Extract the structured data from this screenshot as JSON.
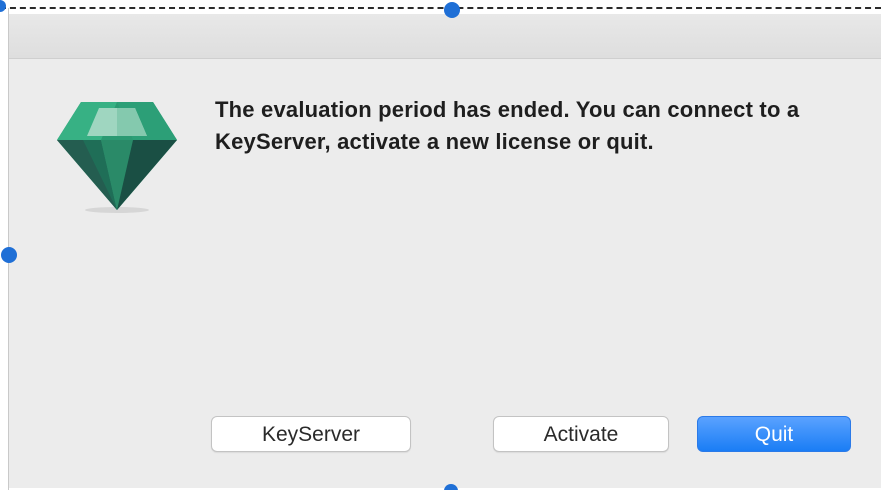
{
  "dialog": {
    "message": "The evaluation period has ended. You can connect to a KeyServer, activate a new license or quit.",
    "app_icon": "gem-icon"
  },
  "buttons": {
    "keyserver_label": "KeyServer",
    "activate_label": "Activate",
    "quit_label": "Quit"
  },
  "colors": {
    "accent": "#1a7df5",
    "selection_handle": "#1f6fd6",
    "gem_primary": "#2a9a72"
  }
}
